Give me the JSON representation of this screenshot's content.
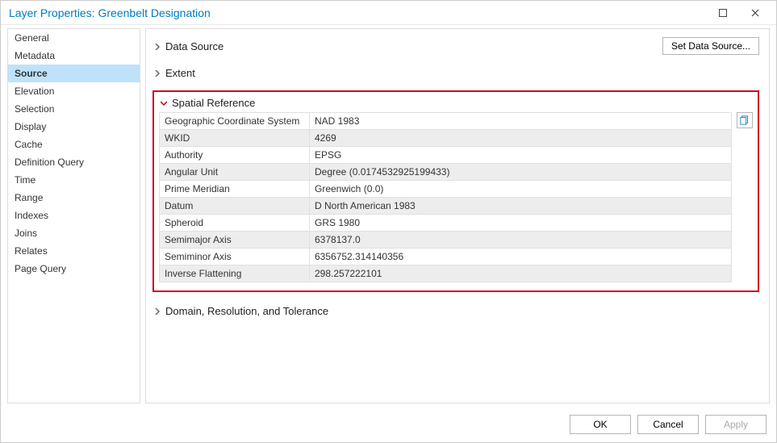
{
  "window": {
    "title": "Layer Properties: Greenbelt Designation"
  },
  "sidebar": {
    "items": [
      {
        "label": "General"
      },
      {
        "label": "Metadata"
      },
      {
        "label": "Source",
        "selected": true
      },
      {
        "label": "Elevation"
      },
      {
        "label": "Selection"
      },
      {
        "label": "Display"
      },
      {
        "label": "Cache"
      },
      {
        "label": "Definition Query"
      },
      {
        "label": "Time"
      },
      {
        "label": "Range"
      },
      {
        "label": "Indexes"
      },
      {
        "label": "Joins"
      },
      {
        "label": "Relates"
      },
      {
        "label": "Page Query"
      }
    ]
  },
  "content": {
    "set_data_source": "Set Data Source...",
    "sections": {
      "data_source": "Data Source",
      "extent": "Extent",
      "spatial_ref": "Spatial Reference",
      "domain": "Domain, Resolution, and Tolerance"
    },
    "spatial_reference": {
      "rows": [
        {
          "key": "Geographic Coordinate System",
          "value": "NAD 1983"
        },
        {
          "key": "WKID",
          "value": "4269"
        },
        {
          "key": "Authority",
          "value": "EPSG"
        },
        {
          "key": "Angular Unit",
          "value": "Degree (0.0174532925199433)"
        },
        {
          "key": "Prime Meridian",
          "value": "Greenwich (0.0)"
        },
        {
          "key": "Datum",
          "value": "D North American 1983"
        },
        {
          "key": "Spheroid",
          "value": "GRS 1980"
        },
        {
          "key": "Semimajor Axis",
          "value": "6378137.0"
        },
        {
          "key": "Semiminor Axis",
          "value": "6356752.314140356"
        },
        {
          "key": "Inverse Flattening",
          "value": "298.257222101"
        }
      ]
    }
  },
  "footer": {
    "ok": "OK",
    "cancel": "Cancel",
    "apply": "Apply"
  }
}
